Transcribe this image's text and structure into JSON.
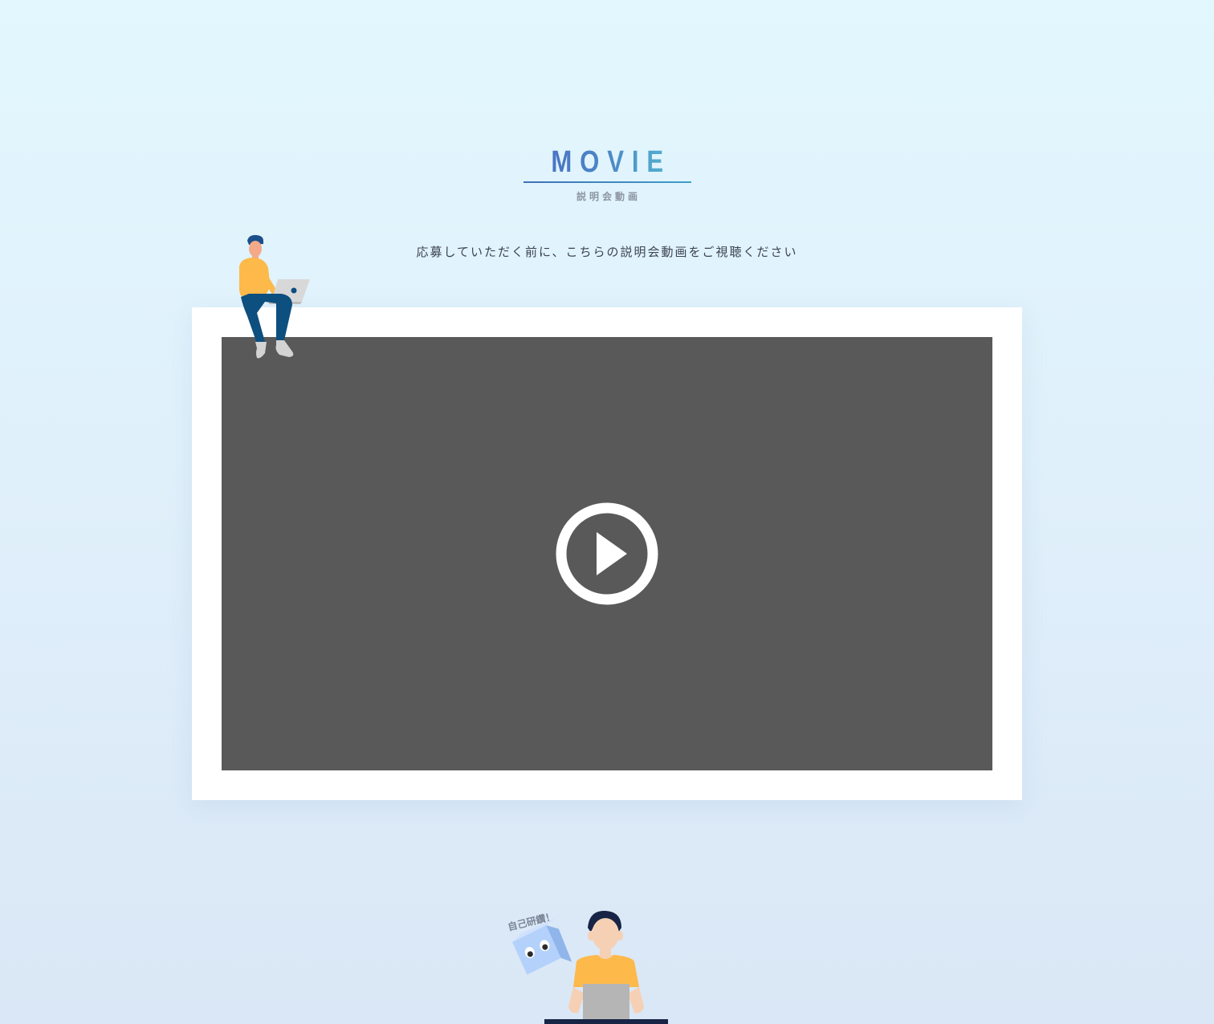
{
  "section": {
    "title": "MOVIE",
    "subtitle": "説明会動画",
    "intro": "応募していただく前に、こちらの説明会動画をご視聴ください"
  },
  "illustration": {
    "box_label": "自己研鑽！"
  },
  "colors": {
    "title_gradient_start": "#4a72c4",
    "title_gradient_end": "#52b2d0",
    "video_background": "#595959",
    "frame": "#ffffff",
    "shirt": "#fdb94a",
    "pants": "#0d4f7e",
    "box": "#b3d1fb"
  },
  "icons": {
    "play": "play-circle-icon"
  }
}
